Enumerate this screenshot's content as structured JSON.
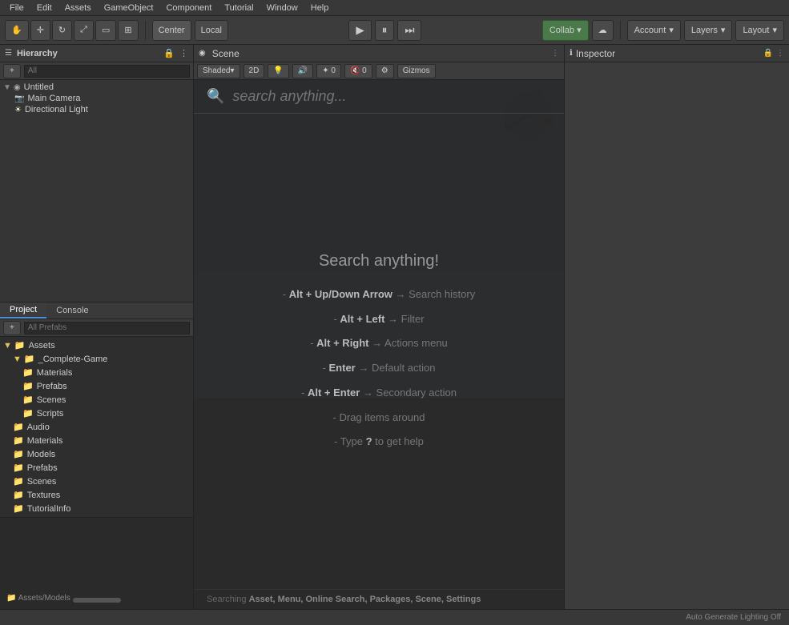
{
  "menubar": {
    "items": [
      "File",
      "Edit",
      "Assets",
      "GameObject",
      "Component",
      "Tutorial",
      "Window",
      "Help"
    ]
  },
  "toolbar": {
    "transform_tools": [
      "hand",
      "move",
      "rotate",
      "scale",
      "rect",
      "custom"
    ],
    "center_btn": "Center",
    "local_btn": "Local",
    "play": "▶",
    "pause": "⏸",
    "step": "⏭",
    "collab": "Collab ▾",
    "cloud": "☁",
    "account": "Account",
    "layers": "Layers",
    "layout": "Layout"
  },
  "hierarchy": {
    "panel_title": "Hierarchy",
    "all_label": "All",
    "items": [
      {
        "label": "Untitled",
        "level": 0,
        "arrow": "▼",
        "type": "scene"
      },
      {
        "label": "Main Camera",
        "level": 1,
        "arrow": "",
        "type": "camera"
      },
      {
        "label": "Directional Light",
        "level": 1,
        "arrow": "",
        "type": "light"
      }
    ]
  },
  "scene": {
    "panel_title": "Scene",
    "shading": "Shaded",
    "mode_2d": "2D",
    "gizmos": "Gizmos"
  },
  "search_overlay": {
    "placeholder": "search anything...",
    "title": "Search anything!",
    "shortcuts": [
      {
        "text": "- ",
        "bold": "Alt + Up/Down Arrow",
        "rest": " → Search history"
      },
      {
        "text": "- ",
        "bold": "Alt + Left",
        "rest": " → Filter"
      },
      {
        "text": "- ",
        "bold": "Alt + Right",
        "rest": " → Actions menu"
      },
      {
        "text": "- ",
        "bold": "Enter",
        "rest": " → Default action"
      },
      {
        "text": "- ",
        "bold": "Alt + Enter",
        "rest": " → Secondary action"
      },
      {
        "text": "- Drag items around",
        "bold": "",
        "rest": ""
      },
      {
        "text": "- Type ",
        "bold": "?",
        "rest": " to get help"
      }
    ],
    "footer": "Searching Asset, Menu, Online Search, Packages, Scene, Settings"
  },
  "inspector": {
    "panel_title": "Inspector"
  },
  "project": {
    "tabs": [
      "Project",
      "Console"
    ],
    "active_tab": "Project",
    "all_prefabs": "All Prefabs",
    "assets_root": "Assets",
    "items": [
      {
        "label": "_Complete-Game",
        "level": 1,
        "type": "folder",
        "open": true
      },
      {
        "label": "Materials",
        "level": 2,
        "type": "folder"
      },
      {
        "label": "Prefabs",
        "level": 2,
        "type": "folder"
      },
      {
        "label": "Scenes",
        "level": 2,
        "type": "folder"
      },
      {
        "label": "Scripts",
        "level": 2,
        "type": "folder"
      },
      {
        "label": "Audio",
        "level": 1,
        "type": "folder"
      },
      {
        "label": "Materials",
        "level": 1,
        "type": "folder"
      },
      {
        "label": "Models",
        "level": 1,
        "type": "folder"
      },
      {
        "label": "Prefabs",
        "level": 1,
        "type": "folder"
      },
      {
        "label": "Scenes",
        "level": 1,
        "type": "folder"
      },
      {
        "label": "Textures",
        "level": 1,
        "type": "folder"
      },
      {
        "label": "TutorialInfo",
        "level": 1,
        "type": "folder"
      }
    ]
  },
  "bottom_area": {
    "path": "Assets/Models"
  },
  "status_bar": {
    "text": "Auto Generate Lighting Off"
  }
}
